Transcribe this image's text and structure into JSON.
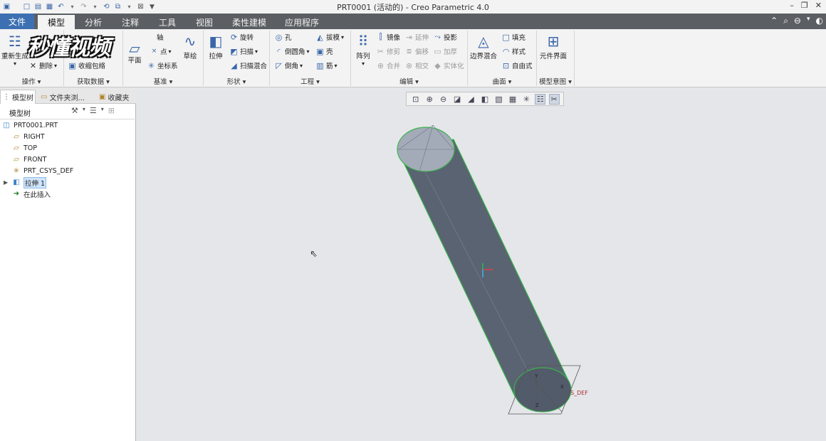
{
  "titlebar": {
    "title": "PRT0001 (活动的) - Creo Parametric 4.0",
    "window_controls": {
      "minimize": "–",
      "restore": "❐",
      "close": "✕"
    }
  },
  "menu": {
    "tabs": [
      {
        "label": "文件"
      },
      {
        "label": "模型"
      },
      {
        "label": "分析"
      },
      {
        "label": "注释"
      },
      {
        "label": "工具"
      },
      {
        "label": "视图"
      },
      {
        "label": "柔性建模"
      },
      {
        "label": "应用程序"
      }
    ],
    "active_tab": "模型"
  },
  "ribbon": {
    "operations": {
      "regenerate": "重新生成",
      "delete": "删除",
      "label": "操作"
    },
    "get_data": {
      "shrinkwrap": "收缩包络",
      "label": "获取数据"
    },
    "datum": {
      "axis": "轴",
      "point": "点",
      "coord_sys": "坐标系",
      "plane": "平面",
      "sketch": "草绘",
      "label": "基准"
    },
    "shapes": {
      "extrude": "拉伸",
      "revolve": "旋转",
      "sweep": "扫描",
      "swept_blend": "扫描混合",
      "label": "形状"
    },
    "engineering": {
      "hole": "孔",
      "draft": "拔模",
      "round": "倒圆角",
      "shell": "壳",
      "chamfer": "倒角",
      "rib": "筋",
      "label": "工程"
    },
    "editing": {
      "pattern": "阵列",
      "mirror": "镜像",
      "extend": "延伸",
      "project": "投影",
      "trim": "修剪",
      "offset": "偏移",
      "thicken": "加厚",
      "merge": "合并",
      "intersect": "相交",
      "solidify": "实体化",
      "label": "编辑"
    },
    "surfaces": {
      "boundary_blend": "边界混合",
      "fill": "填充",
      "style": "样式",
      "freestyle": "自由式",
      "label": "曲面"
    },
    "model_intent": {
      "component_interface": "元件界面",
      "label": "模型意图"
    }
  },
  "watermark": "秒懂视频",
  "left_panel": {
    "tabs": [
      {
        "label": "模型树"
      },
      {
        "label": "文件夹浏..."
      },
      {
        "label": "收藏夹"
      }
    ],
    "tree_header": "模型树",
    "tree": [
      {
        "label": "PRT0001.PRT",
        "icon": "part-icon"
      },
      {
        "label": "RIGHT",
        "icon": "datum-plane-icon"
      },
      {
        "label": "TOP",
        "icon": "datum-plane-icon"
      },
      {
        "label": "FRONT",
        "icon": "datum-plane-icon"
      },
      {
        "label": "PRT_CSYS_DEF",
        "icon": "csys-icon"
      },
      {
        "label": "拉伸 1",
        "icon": "extrude-icon",
        "selected": true
      },
      {
        "label": "在此插入",
        "icon": "insert-here-icon"
      }
    ]
  },
  "viewport": {
    "csys_label": "S_DEF",
    "axis_labels": {
      "x": "X",
      "y": "Y",
      "z": "Z"
    }
  },
  "colors": {
    "menubar": "#5b5e63",
    "file_tab": "#3d70b2",
    "model_body": "#5a6372",
    "model_cap": "#a3aab8",
    "edge_highlight": "#39b44a",
    "selection": "#cfe4fb"
  }
}
